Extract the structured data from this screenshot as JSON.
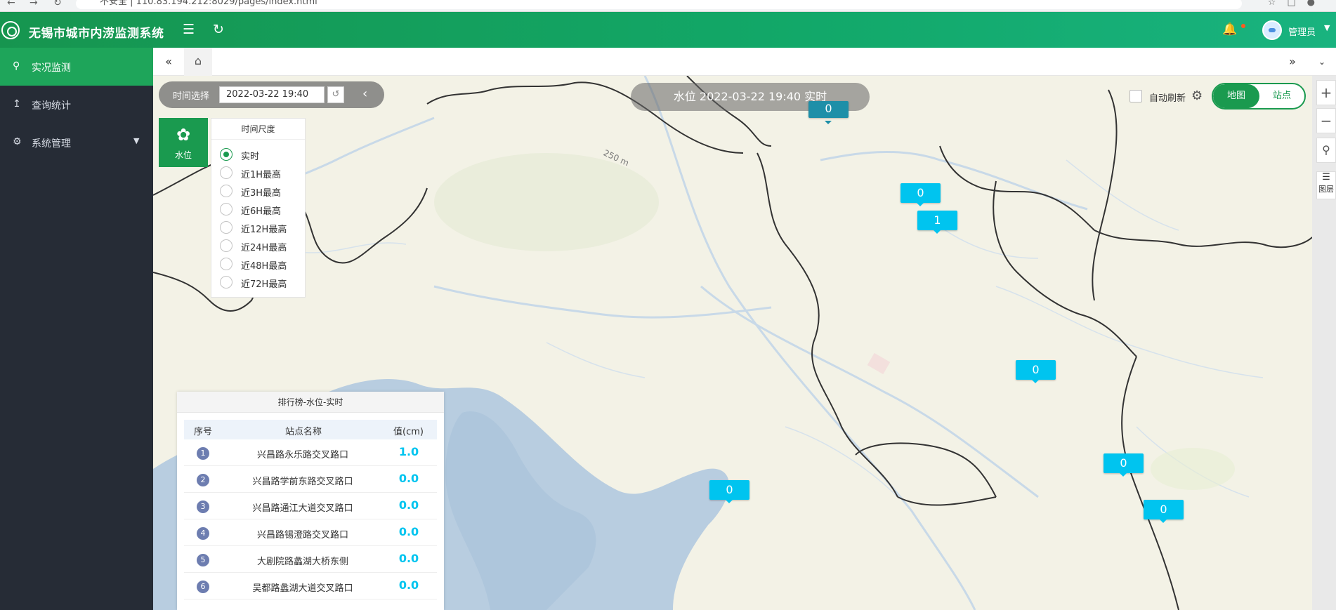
{
  "browser": {
    "url": "不安全 | 110.83.194.212:8029/pages/index.html"
  },
  "header": {
    "title": "无锡市城市内涝监测系统",
    "user_name": "管理员"
  },
  "sidebar": {
    "items": [
      {
        "label": "实况监测",
        "icon": "location-pin-icon",
        "active": true
      },
      {
        "label": "查询统计",
        "icon": "pulse-icon",
        "active": false
      },
      {
        "label": "系统管理",
        "icon": "gear-icon",
        "active": false,
        "has_submenu": true
      }
    ]
  },
  "time_selector": {
    "label": "时间选择",
    "value": "2022-03-22 19:40"
  },
  "map_title": "水位 2022-03-22 19:40 实时",
  "layer_button": {
    "label": "水位",
    "icon": "leaf-icon"
  },
  "time_scale": {
    "title": "时间尺度",
    "selected": "实时",
    "options": [
      "实时",
      "近1H最高",
      "近3H最高",
      "近6H最高",
      "近12H最高",
      "近24H最高",
      "近48H最高",
      "近72H最高"
    ]
  },
  "controls": {
    "auto_refresh_label": "自动刷新",
    "auto_refresh_checked": false,
    "view_map": "地图",
    "view_station": "站点",
    "active_view": "地图",
    "layers_label": "图层"
  },
  "map_scale_label": "250 m",
  "markers": [
    "0",
    "0",
    "1",
    "0",
    "0",
    "0",
    "0"
  ],
  "ranking": {
    "title": "排行榜-水位-实时",
    "columns": [
      "序号",
      "站点名称",
      "值(cm)"
    ],
    "rows": [
      {
        "rank": "1",
        "name": "兴昌路永乐路交叉路口",
        "value": "1.0"
      },
      {
        "rank": "2",
        "name": "兴昌路学前东路交叉路口",
        "value": "0.0"
      },
      {
        "rank": "3",
        "name": "兴昌路通江大道交叉路口",
        "value": "0.0"
      },
      {
        "rank": "4",
        "name": "兴昌路锡澄路交叉路口",
        "value": "0.0"
      },
      {
        "rank": "5",
        "name": "大剧院路蠡湖大桥东侧",
        "value": "0.0"
      },
      {
        "rank": "6",
        "name": "吴都路蠡湖大道交叉路口",
        "value": "0.0"
      }
    ]
  },
  "colors": {
    "brand_green": "#1a9a4f",
    "marker_cyan": "#00c4ef",
    "sidebar_bg": "#262c36"
  }
}
